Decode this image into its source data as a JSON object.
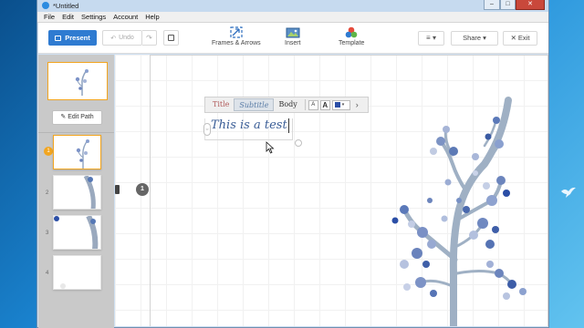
{
  "window": {
    "title": "*Untitled",
    "controls": {
      "minimize": "–",
      "maximize": "□",
      "close": "✕"
    }
  },
  "menubar": {
    "items": [
      "File",
      "Edit",
      "Settings",
      "Account",
      "Help"
    ]
  },
  "toolbar": {
    "present_label": "Present",
    "undo_label": "Undo",
    "redo_icon": "redo-icon",
    "save_icon": "save-icon",
    "frames_label": "Frames & Arrows",
    "insert_label": "Insert",
    "template_label": "Template",
    "menu_label": "≡ ▾",
    "share_label": "Share ▾",
    "exit_label": "✕  Exit",
    "accent_color": "#2f7bd1"
  },
  "sidebar": {
    "edit_path_label": "✎ Edit Path",
    "selected_badge": "1",
    "thumbnails": [
      {
        "num": "1"
      },
      {
        "num": "2"
      },
      {
        "num": "3"
      },
      {
        "num": "4"
      }
    ]
  },
  "canvas": {
    "path_marker": "1",
    "format_bar": {
      "styles": [
        "Title",
        "Subtitle",
        "Body"
      ],
      "selected_style": "Subtitle",
      "font_small": "A",
      "font_big": "A",
      "color_arrow": "▾",
      "next_arrow": "›",
      "text_color": "#2b4ea6"
    },
    "text": "This is a test",
    "handle_icon": "⇔"
  }
}
